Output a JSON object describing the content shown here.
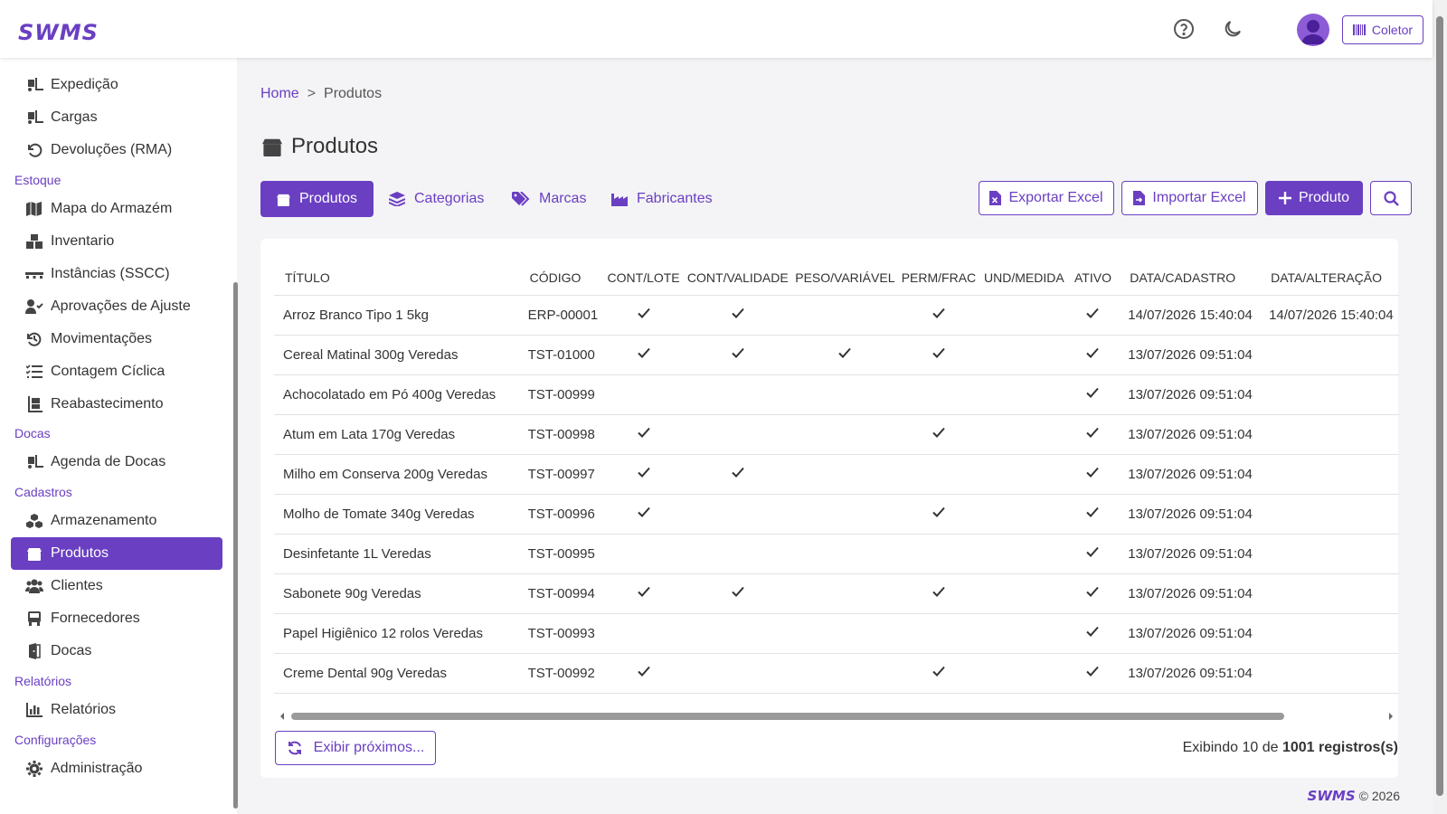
{
  "header": {
    "logo": "SWMS",
    "coletor_label": "Coletor",
    "icons": [
      "help-icon",
      "moon-icon",
      "user-icon",
      "barcode-icon"
    ]
  },
  "sidebar": {
    "items": [
      {
        "label": "Expedição",
        "icon": "truck-loading-icon"
      },
      {
        "label": "Cargas",
        "icon": "truck-loading-icon"
      },
      {
        "label": "Devoluções (RMA)",
        "icon": "undo-icon"
      },
      {
        "section": "Estoque"
      },
      {
        "label": "Mapa do Armazém",
        "icon": "map-icon"
      },
      {
        "label": "Inventario",
        "icon": "boxes-icon"
      },
      {
        "label": "Instâncias (SSCC)",
        "icon": "pallet-icon"
      },
      {
        "label": "Aprovações de Ajuste",
        "icon": "user-check-icon"
      },
      {
        "label": "Movimentações",
        "icon": "history-icon"
      },
      {
        "label": "Contagem Cíclica",
        "icon": "list-check-icon"
      },
      {
        "label": "Reabastecimento",
        "icon": "dolly-icon"
      },
      {
        "section": "Docas"
      },
      {
        "label": "Agenda de Docas",
        "icon": "truck-loading-icon"
      },
      {
        "section": "Cadastros"
      },
      {
        "label": "Armazenamento",
        "icon": "cubes-icon"
      },
      {
        "label": "Produtos",
        "icon": "box-icon",
        "active": true
      },
      {
        "label": "Clientes",
        "icon": "users-icon"
      },
      {
        "label": "Fornecedores",
        "icon": "truck-icon"
      },
      {
        "label": "Docas",
        "icon": "door-icon"
      },
      {
        "section": "Relatórios"
      },
      {
        "label": "Relatórios",
        "icon": "chart-bar-icon"
      },
      {
        "section": "Configurações"
      },
      {
        "label": "Administração",
        "icon": "gear-icon"
      }
    ]
  },
  "breadcrumb": {
    "home": "Home",
    "separator": ">",
    "current": "Produtos"
  },
  "page_title": "Produtos",
  "tabs": [
    {
      "label": "Produtos",
      "icon": "box-icon",
      "active": true
    },
    {
      "label": "Categorias",
      "icon": "layers-icon"
    },
    {
      "label": "Marcas",
      "icon": "tags-icon"
    },
    {
      "label": "Fabricantes",
      "icon": "industry-icon"
    }
  ],
  "actions": {
    "export": "Exportar Excel",
    "import": "Importar Excel",
    "add": "Produto"
  },
  "table": {
    "columns": [
      "TÍTULO",
      "CÓDIGO",
      "CONT/LOTE",
      "CONT/VALIDADE",
      "PESO/VARIÁVEL",
      "PERM/FRAC",
      "UND/MEDIDA",
      "ATIVO",
      "DATA/CADASTRO",
      "DATA/ALTERAÇÃO"
    ],
    "rows": [
      {
        "titulo": "Arroz Branco Tipo 1 5kg",
        "codigo": "ERP-00001",
        "lote": true,
        "validade": true,
        "peso": false,
        "frac": true,
        "und": "",
        "ativo": true,
        "cadastro": "14/07/2026 15:40:04",
        "alteracao": "14/07/2026 15:40:04"
      },
      {
        "titulo": "Cereal Matinal 300g Veredas",
        "codigo": "TST-01000",
        "lote": true,
        "validade": true,
        "peso": true,
        "frac": true,
        "und": "",
        "ativo": true,
        "cadastro": "13/07/2026 09:51:04",
        "alteracao": ""
      },
      {
        "titulo": "Achocolatado em Pó 400g Veredas",
        "codigo": "TST-00999",
        "lote": false,
        "validade": false,
        "peso": false,
        "frac": false,
        "und": "",
        "ativo": true,
        "cadastro": "13/07/2026 09:51:04",
        "alteracao": ""
      },
      {
        "titulo": "Atum em Lata 170g Veredas",
        "codigo": "TST-00998",
        "lote": true,
        "validade": false,
        "peso": false,
        "frac": true,
        "und": "",
        "ativo": true,
        "cadastro": "13/07/2026 09:51:04",
        "alteracao": ""
      },
      {
        "titulo": "Milho em Conserva 200g Veredas",
        "codigo": "TST-00997",
        "lote": true,
        "validade": true,
        "peso": false,
        "frac": false,
        "und": "",
        "ativo": true,
        "cadastro": "13/07/2026 09:51:04",
        "alteracao": ""
      },
      {
        "titulo": "Molho de Tomate 340g Veredas",
        "codigo": "TST-00996",
        "lote": true,
        "validade": false,
        "peso": false,
        "frac": true,
        "und": "",
        "ativo": true,
        "cadastro": "13/07/2026 09:51:04",
        "alteracao": ""
      },
      {
        "titulo": "Desinfetante 1L Veredas",
        "codigo": "TST-00995",
        "lote": false,
        "validade": false,
        "peso": false,
        "frac": false,
        "und": "",
        "ativo": true,
        "cadastro": "13/07/2026 09:51:04",
        "alteracao": ""
      },
      {
        "titulo": "Sabonete 90g Veredas",
        "codigo": "TST-00994",
        "lote": true,
        "validade": true,
        "peso": false,
        "frac": true,
        "und": "",
        "ativo": true,
        "cadastro": "13/07/2026 09:51:04",
        "alteracao": ""
      },
      {
        "titulo": "Papel Higiênico 12 rolos Veredas",
        "codigo": "TST-00993",
        "lote": false,
        "validade": false,
        "peso": false,
        "frac": false,
        "und": "",
        "ativo": true,
        "cadastro": "13/07/2026 09:51:04",
        "alteracao": ""
      },
      {
        "titulo": "Creme Dental 90g Veredas",
        "codigo": "TST-00992",
        "lote": true,
        "validade": false,
        "peso": false,
        "frac": true,
        "und": "",
        "ativo": true,
        "cadastro": "13/07/2026 09:51:04",
        "alteracao": ""
      }
    ]
  },
  "pagination": {
    "next_label": "Exibir próximos...",
    "showing_prefix": "Exibindo 10 de ",
    "total": "1001 registros(s)"
  },
  "footer": {
    "logo": "SWMS",
    "copyright": "© 2026"
  },
  "colors": {
    "accent": "#6a3fc2"
  }
}
